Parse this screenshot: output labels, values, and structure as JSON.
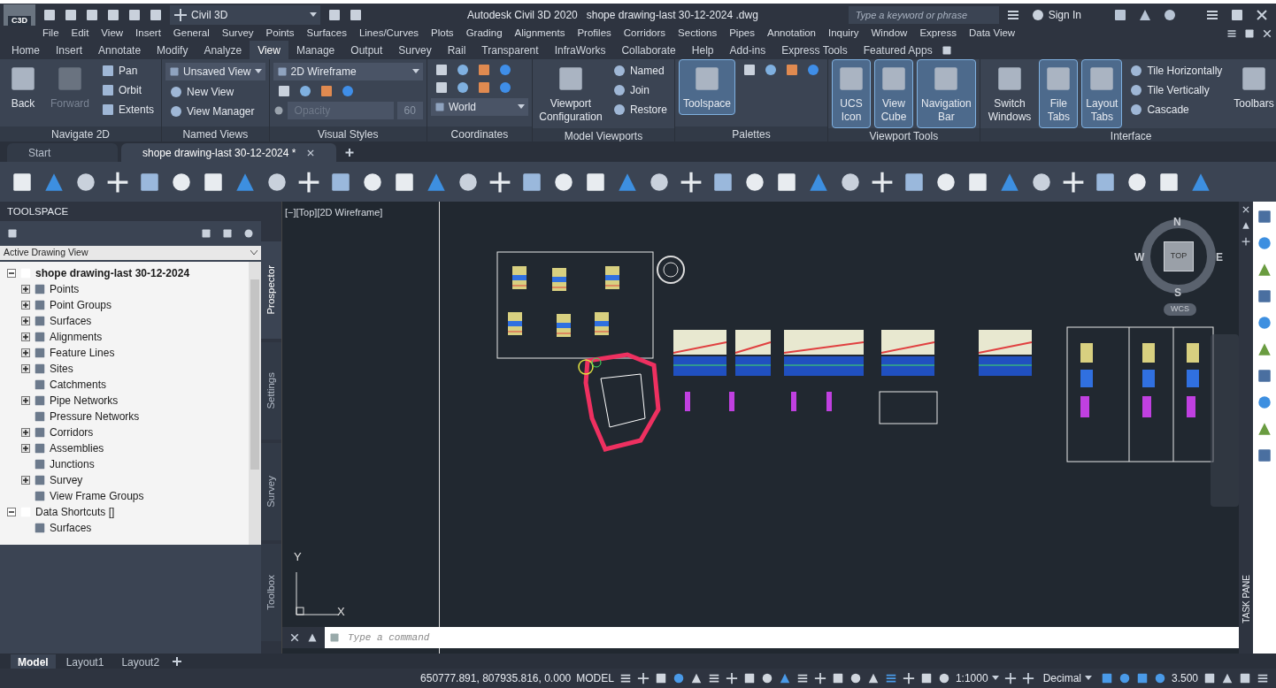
{
  "title_bar": {
    "app_badge": "C3D",
    "workspace": "Civil 3D",
    "title": "Autodesk Civil 3D 2020   shope drawing-last 30-12-2024 .dwg",
    "search": {
      "placeholder": "Type a keyword or phrase"
    },
    "sign_in": "Sign In"
  },
  "menu_bar": [
    "File",
    "Edit",
    "View",
    "Insert",
    "General",
    "Survey",
    "Points",
    "Surfaces",
    "Lines/Curves",
    "Plots",
    "Grading",
    "Alignments",
    "Profiles",
    "Corridors",
    "Sections",
    "Pipes",
    "Annotation",
    "Inquiry",
    "Window",
    "Express",
    "Data View"
  ],
  "ribbon_tabs": [
    {
      "label": "Home",
      "selected": false
    },
    {
      "label": "Insert",
      "selected": false
    },
    {
      "label": "Annotate",
      "selected": false
    },
    {
      "label": "Modify",
      "selected": false
    },
    {
      "label": "Analyze",
      "selected": false
    },
    {
      "label": "View",
      "selected": true
    },
    {
      "label": "Manage",
      "selected": false
    },
    {
      "label": "Output",
      "selected": false
    },
    {
      "label": "Survey",
      "selected": false
    },
    {
      "label": "Rail",
      "selected": false
    },
    {
      "label": "Transparent",
      "selected": false
    },
    {
      "label": "InfraWorks",
      "selected": false
    },
    {
      "label": "Collaborate",
      "selected": false
    },
    {
      "label": "Help",
      "selected": false
    },
    {
      "label": "Add-ins",
      "selected": false
    },
    {
      "label": "Express Tools",
      "selected": false
    },
    {
      "label": "Featured Apps",
      "selected": false
    }
  ],
  "ribbon_panels": [
    {
      "title": "Navigate 2D",
      "items": [
        {
          "kind": "large",
          "label": "Back",
          "selected": false,
          "disabled": false
        },
        {
          "kind": "large",
          "label": "Forward",
          "selected": false,
          "disabled": true
        },
        {
          "kind": "small",
          "label": "Pan"
        },
        {
          "kind": "small",
          "label": "Orbit"
        },
        {
          "kind": "small",
          "label": "Extents"
        }
      ]
    },
    {
      "title": "Named Views",
      "items": [
        {
          "kind": "dropdown",
          "value": "Unsaved View"
        },
        {
          "kind": "small",
          "label": "New View"
        },
        {
          "kind": "small",
          "label": "View Manager"
        }
      ]
    },
    {
      "title": "Visual Styles",
      "items": [
        {
          "kind": "dropdown",
          "value": "2D Wireframe"
        },
        {
          "kind": "icons"
        },
        {
          "kind": "field",
          "placeholder": "Opacity",
          "value": "60"
        }
      ]
    },
    {
      "title": "Coordinates",
      "items": [
        {
          "kind": "icons"
        },
        {
          "kind": "icons"
        },
        {
          "kind": "dropdown",
          "value": "World"
        }
      ]
    },
    {
      "title": "Model Viewports",
      "items": [
        {
          "kind": "large",
          "label": "Viewport Configuration",
          "selected": false,
          "disabled": false
        },
        {
          "kind": "small",
          "label": "Named"
        },
        {
          "kind": "small",
          "label": "Join"
        },
        {
          "kind": "small",
          "label": "Restore"
        }
      ]
    },
    {
      "title": "Palettes",
      "items": [
        {
          "kind": "large",
          "label": "Toolspace",
          "selected": true,
          "disabled": false
        },
        {
          "kind": "icons"
        }
      ]
    },
    {
      "title": "Viewport Tools",
      "items": [
        {
          "kind": "large",
          "label": "UCS Icon",
          "selected": true,
          "disabled": false
        },
        {
          "kind": "large",
          "label": "View Cube",
          "selected": true,
          "disabled": false
        },
        {
          "kind": "large",
          "label": "Navigation Bar",
          "selected": true,
          "disabled": false
        }
      ]
    },
    {
      "title": "Interface",
      "items": [
        {
          "kind": "large",
          "label": "Switch Windows",
          "selected": false,
          "disabled": false
        },
        {
          "kind": "large",
          "label": "File Tabs",
          "selected": true,
          "disabled": false
        },
        {
          "kind": "large",
          "label": "Layout Tabs",
          "selected": true,
          "disabled": false
        },
        {
          "kind": "small",
          "label": "Tile Horizontally"
        },
        {
          "kind": "small",
          "label": "Tile Vertically"
        },
        {
          "kind": "small",
          "label": "Cascade"
        },
        {
          "kind": "large",
          "label": "Toolbars",
          "selected": false,
          "disabled": false
        }
      ]
    }
  ],
  "file_tabs": [
    {
      "label": "Start",
      "selected": false
    },
    {
      "label": "shope drawing-last 30-12-2024 *",
      "selected": true
    }
  ],
  "toolspace": {
    "title": "TOOLSPACE",
    "view": "Active Drawing View",
    "tree": [
      {
        "label": "shope drawing-last 30-12-2024",
        "bold": true,
        "expanded": true,
        "children": [
          {
            "label": "Points",
            "expanded": false
          },
          {
            "label": "Point Groups",
            "expanded": false
          },
          {
            "label": "Surfaces",
            "expanded": false
          },
          {
            "label": "Alignments",
            "expanded": false
          },
          {
            "label": "Feature Lines",
            "expanded": false
          },
          {
            "label": "Sites",
            "expanded": false
          },
          {
            "label": "Catchments"
          },
          {
            "label": "Pipe Networks",
            "expanded": false
          },
          {
            "label": "Pressure Networks"
          },
          {
            "label": "Corridors",
            "expanded": false
          },
          {
            "label": "Assemblies",
            "expanded": false
          },
          {
            "label": "Junctions"
          },
          {
            "label": "Survey",
            "expanded": false
          },
          {
            "label": "View Frame Groups"
          }
        ]
      },
      {
        "label": "Data Shortcuts []",
        "bold": false,
        "expanded": true,
        "children": [
          {
            "label": "Surfaces"
          }
        ]
      }
    ],
    "side_tabs": [
      {
        "label": "Prospector",
        "selected": true
      },
      {
        "label": "Settings",
        "selected": false
      },
      {
        "label": "Survey",
        "selected": false
      },
      {
        "label": "Toolbox",
        "selected": false
      }
    ]
  },
  "viewport": {
    "label": "[−][Top][2D Wireframe]",
    "viewcube": {
      "north": "N",
      "south": "S",
      "east": "E",
      "west": "W",
      "face": "TOP",
      "ucs": "WCS"
    },
    "ucs_axes": {
      "y": "Y",
      "x": "X"
    }
  },
  "command_line": {
    "placeholder": "Type a command"
  },
  "task_pane": "TASK PANE",
  "layout_tabs": [
    {
      "label": "Model",
      "selected": true
    },
    {
      "label": "Layout1",
      "selected": false
    },
    {
      "label": "Layout2",
      "selected": false
    }
  ],
  "status_bar": {
    "coordinates": "650777.891, 807935.816, 0.000",
    "space": "MODEL",
    "scale": "1:1000",
    "units": "Decimal",
    "value": "3.500"
  }
}
